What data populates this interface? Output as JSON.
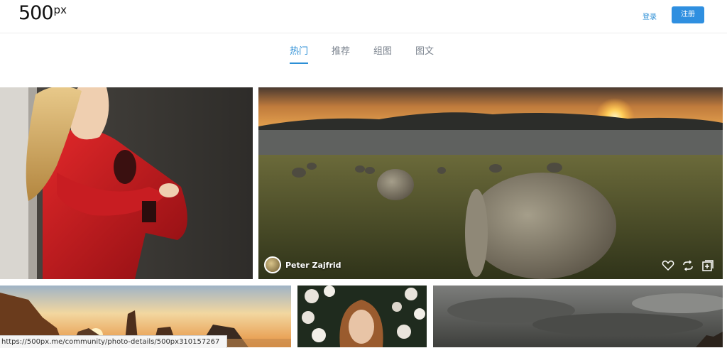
{
  "header": {
    "logo_main": "500",
    "logo_sup": "px",
    "login_label": "登录",
    "signup_label": "注册"
  },
  "tabs": [
    {
      "label": "热门",
      "active": true
    },
    {
      "label": "推荐",
      "active": false
    },
    {
      "label": "组图",
      "active": false
    },
    {
      "label": "图文",
      "active": false
    }
  ],
  "photos": {
    "featured": {
      "author": "Peter Zajfrid",
      "actions": [
        "heart-icon",
        "repost-icon",
        "add-to-gallery-icon"
      ]
    }
  },
  "status_bar": {
    "url": "https://500px.me/community/photo-details/500px310157267"
  },
  "colors": {
    "accent": "#2c8fd6",
    "button": "#2f8fe0",
    "tab_inactive": "#7d8590"
  }
}
